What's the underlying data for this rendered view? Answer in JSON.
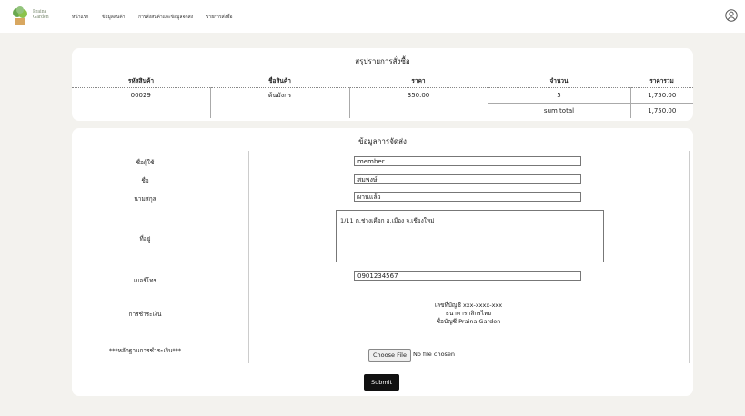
{
  "nav": {
    "logo_line1": "Praina",
    "logo_line2": "Garden",
    "links": [
      "หน้าแรก",
      "ข้อมูลสินค้า",
      "การสั่งสินค้าและข้อมูลจัดส่ง",
      "รายการสั่งซื้อ"
    ]
  },
  "summary": {
    "title": "สรุปรายการสั่งซื้อ",
    "headers": [
      "รหัสสินค้า",
      "ชื่อสินค้า",
      "ราคา",
      "จำนวน",
      "ราคารวม"
    ],
    "row": [
      "00029",
      "ต้นมังกร",
      "350.00",
      "5",
      "1,750.00"
    ],
    "sum_label": "sum total",
    "sum_value": "1,750.00"
  },
  "shipping": {
    "title": "ข้อมูลการจัดส่ง",
    "labels": {
      "username": "ชื่อผู้ใช้",
      "firstname": "ชื่อ",
      "lastname": "นามสกุล",
      "address": "ที่อยู่",
      "phone": "เบอร์โทร",
      "payment": "การชำระเงิน",
      "proof": "***หลักฐานการชำระเงิน***"
    },
    "values": {
      "username": "member",
      "firstname": "สมพงษ์",
      "lastname": "ผานแล้ว",
      "address": "1/11 ต.ช่างเคือก อ.เมือง จ.เชียงใหม่",
      "phone": "0901234567"
    },
    "payment_lines": [
      "เลขที่บัญชี xxx-xxxx-xxx",
      "ธนาคารกสิกรไทย",
      "ชื่อบัญชี Praina Garden"
    ],
    "file_button": "Choose File",
    "file_status": "No file chosen",
    "submit": "Submit"
  }
}
